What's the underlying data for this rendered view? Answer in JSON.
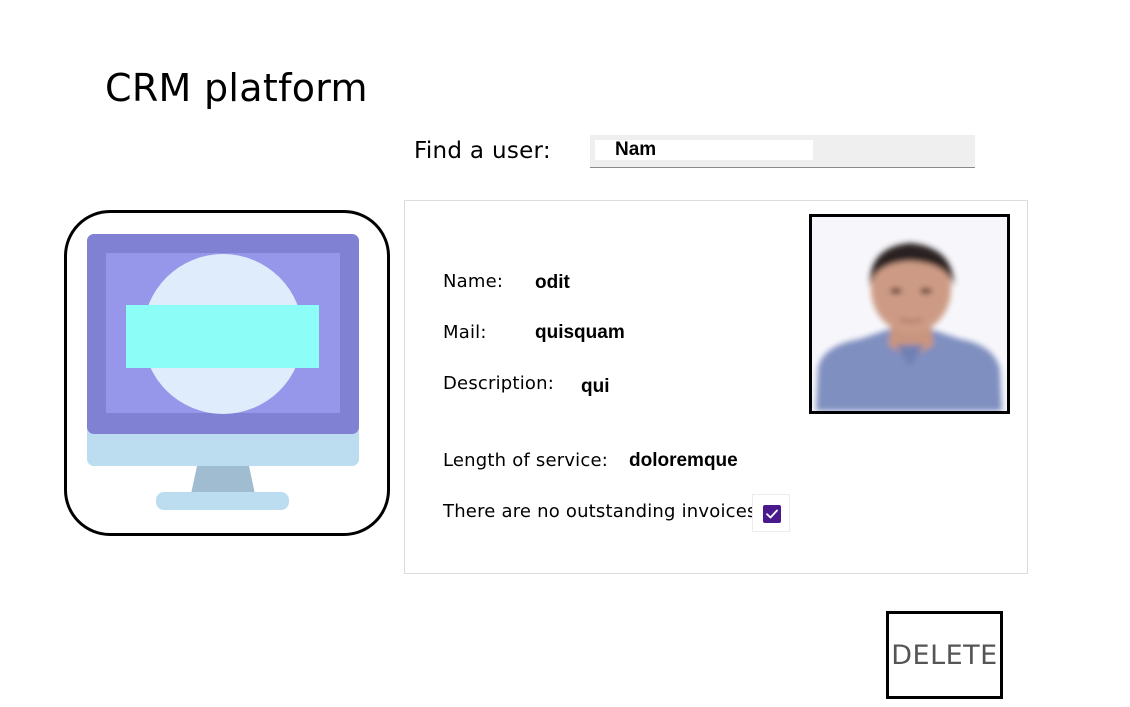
{
  "app": {
    "title": "CRM platform"
  },
  "search": {
    "label": "Find a user:",
    "value": "Nam"
  },
  "illustration": {
    "icon": "computer-monitor-icon",
    "colors": {
      "screen_frame": "#8181d4",
      "screen": "#9696ea",
      "circle": "#deecfc",
      "bar": "#8cfef7",
      "base": "#bcdcf0",
      "stand": "#9fbcd0"
    }
  },
  "user": {
    "name_label": "Name:",
    "name_value": "odit",
    "mail_label": "Mail:",
    "mail_value": "quisquam",
    "description_label": "Description:",
    "description_value": "qui",
    "service_label": "Length of service:",
    "service_value": "doloremque",
    "invoices_label": "There are no outstanding invoices",
    "invoices_checked": true,
    "photo": "user-portrait-photo"
  },
  "actions": {
    "delete_label": "DELETE"
  },
  "colors": {
    "checkbox": "#4a1a8c"
  }
}
